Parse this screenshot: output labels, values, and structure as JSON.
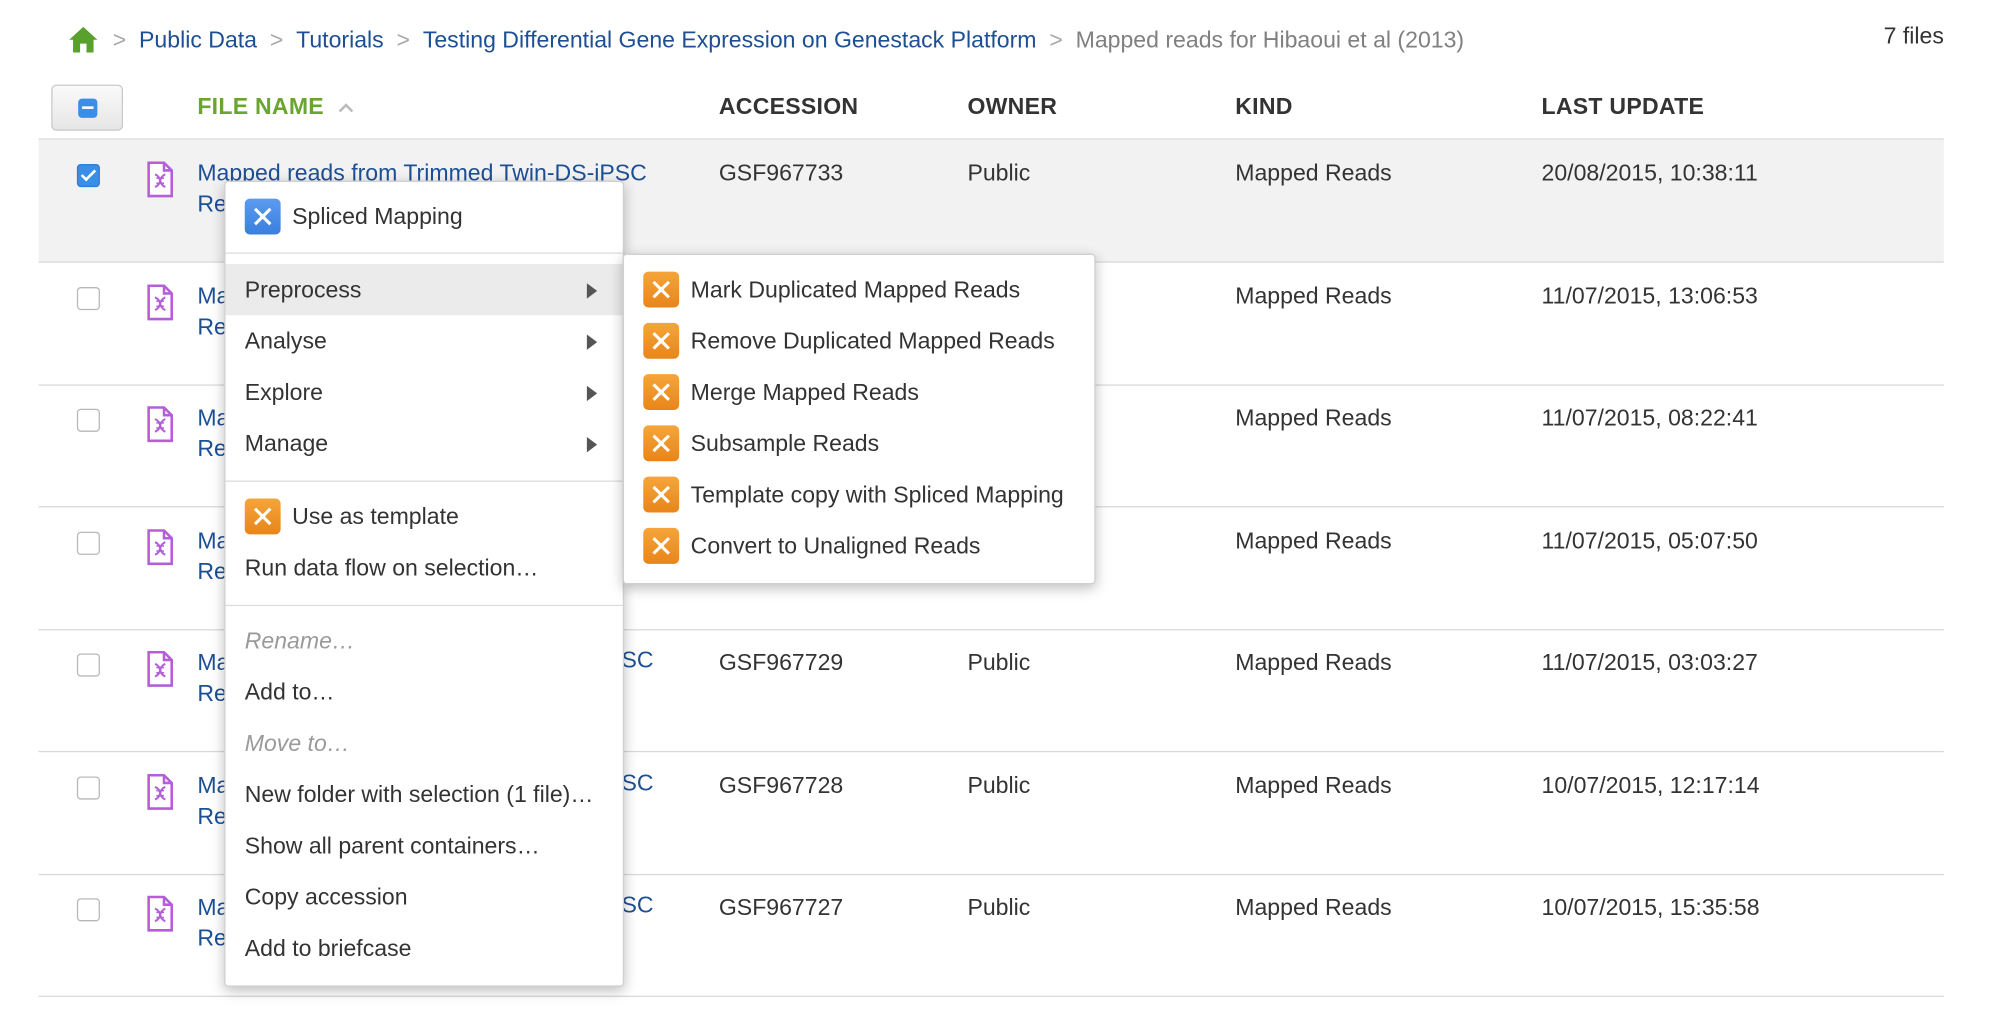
{
  "breadcrumb": {
    "items": [
      "Public Data",
      "Tutorials",
      "Testing Differential Gene Expression on Genestack Platform"
    ],
    "current": "Mapped reads for Hibaoui et al (2013)",
    "separator": ">",
    "file_count": "7 files"
  },
  "table": {
    "columns": [
      "FILE NAME",
      "ACCESSION",
      "OWNER",
      "KIND",
      "LAST UPDATE"
    ],
    "sorted_column": "FILE NAME",
    "sort_direction": "ascending",
    "rows": [
      {
        "name_line1": "Mapped reads from Trimmed Twin-DS-iPSC",
        "name_line2": "Re",
        "accession": "GSF967733",
        "owner": "Public",
        "kind": "Mapped Reads",
        "last_update": "20/08/2015, 10:38:11",
        "checked": true
      },
      {
        "name_line1": "Ma",
        "name_line2": "Re",
        "accession": "",
        "owner": "",
        "kind": "Mapped Reads",
        "last_update": "11/07/2015, 13:06:53",
        "checked": false
      },
      {
        "name_line1": "Ma",
        "name_line2": "Re",
        "accession": "",
        "owner": "",
        "kind": "Mapped Reads",
        "last_update": "11/07/2015, 08:22:41",
        "checked": false
      },
      {
        "name_line1": "Ma",
        "name_line2": "Re",
        "accession": "",
        "owner": "",
        "kind": "Mapped Reads",
        "last_update": "11/07/2015, 05:07:50",
        "checked": false
      },
      {
        "name_line1": "Ma",
        "name_line2": "Re",
        "name_tail": "SC",
        "accession": "GSF967729",
        "owner": "Public",
        "kind": "Mapped Reads",
        "last_update": "11/07/2015, 03:03:27",
        "checked": false
      },
      {
        "name_line1": "Ma",
        "name_line2": "Re",
        "name_tail": "SC",
        "accession": "GSF967728",
        "owner": "Public",
        "kind": "Mapped Reads",
        "last_update": "10/07/2015, 12:17:14",
        "checked": false
      },
      {
        "name_line1": "Ma",
        "name_line2": "Re",
        "name_tail": "SC",
        "accession": "GSF967727",
        "owner": "Public",
        "kind": "Mapped Reads",
        "last_update": "10/07/2015, 15:35:58",
        "checked": false
      }
    ]
  },
  "context_menu": {
    "top_item": {
      "label": "Spliced Mapping",
      "icon": "spliced-mapping-app-icon"
    },
    "submenus": [
      "Preprocess",
      "Analyse",
      "Explore",
      "Manage"
    ],
    "highlighted_submenu": "Preprocess",
    "template_items": [
      {
        "label": "Use as template",
        "icon": "app-icon"
      },
      {
        "label": "Run data flow on selection…"
      }
    ],
    "file_actions": [
      {
        "label": "Rename…",
        "disabled": true
      },
      {
        "label": "Add to…",
        "disabled": false
      },
      {
        "label": "Move to…",
        "disabled": true
      },
      {
        "label": "New folder with selection (1 file)…",
        "disabled": false
      },
      {
        "label": "Show all parent containers…",
        "disabled": false
      },
      {
        "label": "Copy accession",
        "disabled": false
      },
      {
        "label": "Add to briefcase",
        "disabled": false
      }
    ]
  },
  "preprocess_submenu": {
    "items": [
      "Mark Duplicated Mapped Reads",
      "Remove Duplicated Mapped Reads",
      "Merge Mapped Reads",
      "Subsample Reads",
      "Template copy with Spliced Mapping",
      "Convert to Unaligned Reads"
    ],
    "icon": "app-icon"
  },
  "colors": {
    "link": "#1d4f94",
    "sorted_header": "#6ba530",
    "checkbox_accent": "#3a8ee6",
    "app_icon_orange": "#e8851a",
    "app_icon_blue": "#3a7fe0",
    "file_icon": "#b45fd8",
    "home_icon": "#5aa02c"
  }
}
